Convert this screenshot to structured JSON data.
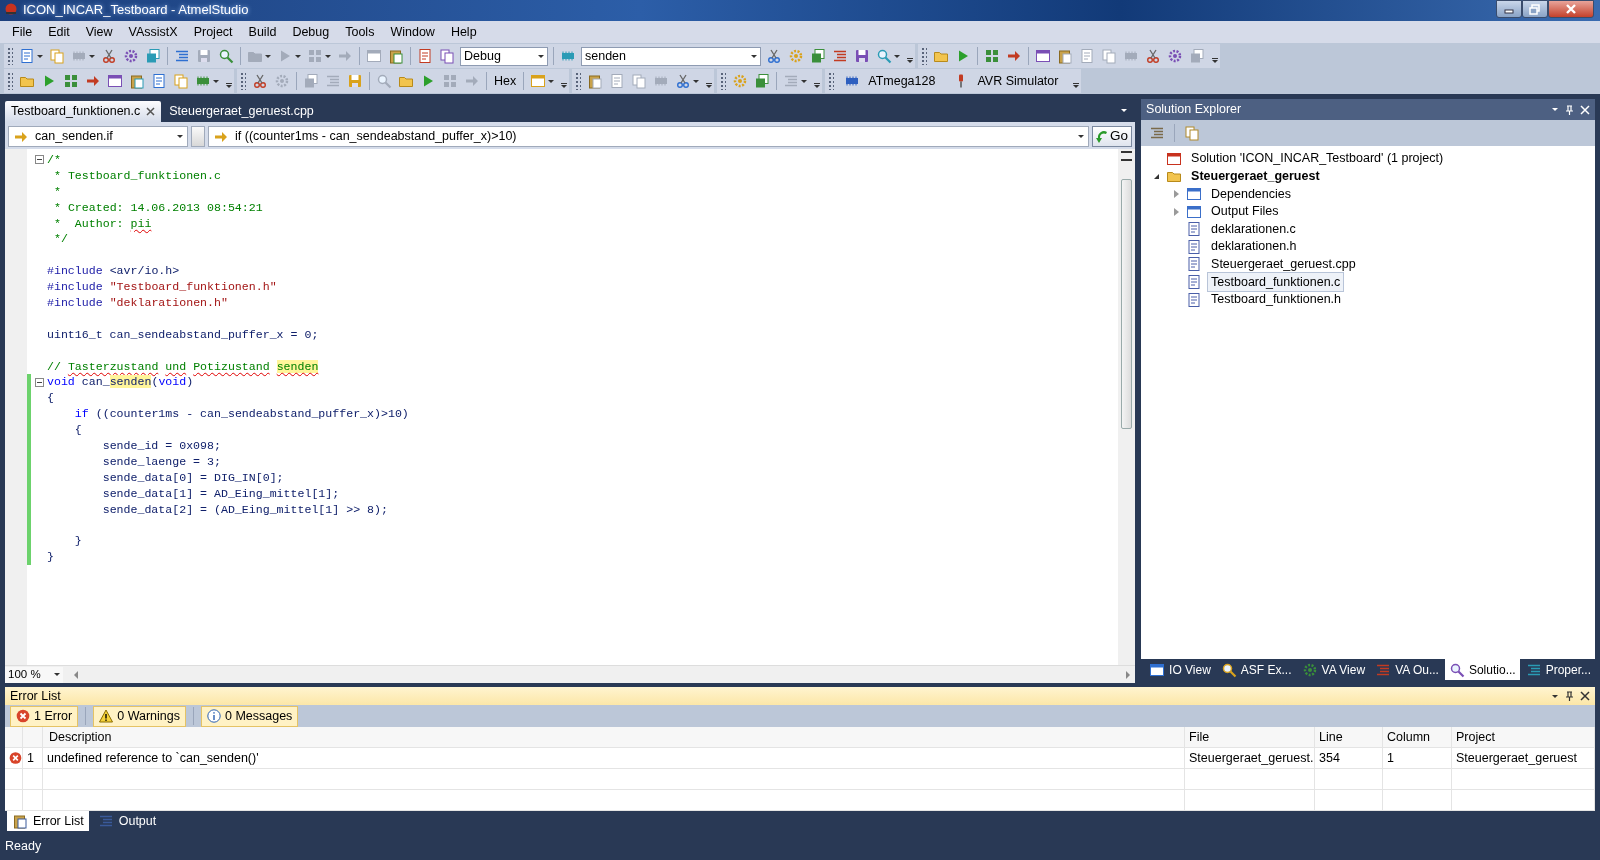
{
  "window": {
    "title": "ICON_INCAR_Testboard - AtmelStudio"
  },
  "menu": [
    "File",
    "Edit",
    "View",
    "VAssistX",
    "Project",
    "Build",
    "Debug",
    "Tools",
    "Window",
    "Help"
  ],
  "toolbar_rows": [
    [
      {
        "kind": "grip"
      },
      {
        "kind": "icon",
        "disabled": false,
        "dropdown": true
      },
      {
        "kind": "icon",
        "disabled": false,
        "dropdown": false
      },
      {
        "kind": "icon",
        "disabled": true,
        "dropdown": true
      },
      {
        "kind": "icon",
        "disabled": false,
        "dropdown": false
      },
      {
        "kind": "icon",
        "disabled": false,
        "dropdown": false
      },
      {
        "kind": "icon",
        "disabled": false,
        "dropdown": false
      },
      {
        "kind": "sep"
      },
      {
        "kind": "icon",
        "disabled": false,
        "dropdown": false
      },
      {
        "kind": "icon",
        "disabled": true,
        "dropdown": false
      },
      {
        "kind": "icon",
        "disabled": false,
        "dropdown": false
      },
      {
        "kind": "sep"
      },
      {
        "kind": "icon",
        "disabled": true,
        "dropdown": true
      },
      {
        "kind": "icon",
        "disabled": true,
        "dropdown": true
      },
      {
        "kind": "icon",
        "disabled": true,
        "dropdown": true
      },
      {
        "kind": "icon",
        "disabled": true,
        "dropdown": false
      },
      {
        "kind": "sep"
      },
      {
        "kind": "icon",
        "disabled": true,
        "dropdown": false
      },
      {
        "kind": "icon",
        "disabled": false,
        "dropdown": false
      },
      {
        "kind": "sep"
      },
      {
        "kind": "icon",
        "disabled": false,
        "dropdown": false
      },
      {
        "kind": "icon",
        "disabled": false,
        "dropdown": false
      },
      {
        "kind": "combo",
        "value": "Debug"
      },
      {
        "kind": "sep"
      },
      {
        "kind": "icon",
        "disabled": false,
        "dropdown": false
      },
      {
        "kind": "combo",
        "value": "senden"
      },
      {
        "kind": "icon",
        "disabled": false,
        "dropdown": false
      },
      {
        "kind": "icon",
        "disabled": false,
        "dropdown": false
      },
      {
        "kind": "icon",
        "disabled": false,
        "dropdown": false
      },
      {
        "kind": "icon",
        "disabled": false,
        "dropdown": false
      },
      {
        "kind": "icon",
        "disabled": false,
        "dropdown": false
      },
      {
        "kind": "icon",
        "disabled": false,
        "dropdown": true
      },
      {
        "kind": "overflow"
      },
      {
        "kind": "grip"
      },
      {
        "kind": "icon",
        "disabled": false,
        "dropdown": false
      },
      {
        "kind": "icon",
        "disabled": false,
        "dropdown": false
      },
      {
        "kind": "sep"
      },
      {
        "kind": "icon",
        "disabled": false,
        "dropdown": false
      },
      {
        "kind": "icon",
        "disabled": false,
        "dropdown": false
      },
      {
        "kind": "sep"
      },
      {
        "kind": "icon",
        "disabled": false,
        "dropdown": false
      },
      {
        "kind": "icon",
        "disabled": true,
        "dropdown": false
      },
      {
        "kind": "icon",
        "disabled": true,
        "dropdown": false
      },
      {
        "kind": "icon",
        "disabled": true,
        "dropdown": false
      },
      {
        "kind": "icon",
        "disabled": true,
        "dropdown": false
      },
      {
        "kind": "icon",
        "disabled": false,
        "dropdown": false
      },
      {
        "kind": "icon",
        "disabled": false,
        "dropdown": false
      },
      {
        "kind": "icon",
        "disabled": true,
        "dropdown": false
      },
      {
        "kind": "overflow"
      }
    ],
    [
      {
        "kind": "grip"
      },
      {
        "kind": "icon",
        "disabled": false,
        "dropdown": false
      },
      {
        "kind": "icon",
        "disabled": false,
        "dropdown": false
      },
      {
        "kind": "icon",
        "disabled": false,
        "dropdown": false
      },
      {
        "kind": "icon",
        "disabled": false,
        "dropdown": false
      },
      {
        "kind": "icon",
        "disabled": false,
        "dropdown": false
      },
      {
        "kind": "icon",
        "disabled": false,
        "dropdown": false
      },
      {
        "kind": "icon",
        "disabled": false,
        "dropdown": false
      },
      {
        "kind": "icon",
        "disabled": false,
        "dropdown": false
      },
      {
        "kind": "icon",
        "disabled": false,
        "dropdown": true
      },
      {
        "kind": "overflow"
      },
      {
        "kind": "grip"
      },
      {
        "kind": "icon",
        "disabled": false,
        "dropdown": false
      },
      {
        "kind": "icon",
        "disabled": true,
        "dropdown": false
      },
      {
        "kind": "sep"
      },
      {
        "kind": "icon",
        "disabled": true,
        "dropdown": false
      },
      {
        "kind": "icon",
        "disabled": true,
        "dropdown": false
      },
      {
        "kind": "icon",
        "disabled": false,
        "dropdown": false
      },
      {
        "kind": "sep"
      },
      {
        "kind": "icon",
        "disabled": true,
        "dropdown": false
      },
      {
        "kind": "icon",
        "disabled": false,
        "dropdown": false
      },
      {
        "kind": "icon",
        "disabled": false,
        "dropdown": false
      },
      {
        "kind": "icon",
        "disabled": true,
        "dropdown": false
      },
      {
        "kind": "icon",
        "disabled": true,
        "dropdown": false
      },
      {
        "kind": "sep"
      },
      {
        "kind": "text",
        "label": "Hex"
      },
      {
        "kind": "sep"
      },
      {
        "kind": "icon",
        "disabled": false,
        "dropdown": true
      },
      {
        "kind": "overflow"
      },
      {
        "kind": "grip"
      },
      {
        "kind": "icon",
        "disabled": true,
        "dropdown": false
      },
      {
        "kind": "icon",
        "disabled": true,
        "dropdown": false
      },
      {
        "kind": "icon",
        "disabled": true,
        "dropdown": false
      },
      {
        "kind": "icon",
        "disabled": true,
        "dropdown": false
      },
      {
        "kind": "icon",
        "disabled": false,
        "dropdown": true
      },
      {
        "kind": "overflow"
      },
      {
        "kind": "grip"
      },
      {
        "kind": "icon",
        "disabled": false,
        "dropdown": false
      },
      {
        "kind": "icon",
        "disabled": false,
        "dropdown": false
      },
      {
        "kind": "sep"
      },
      {
        "kind": "icon",
        "disabled": true,
        "dropdown": true
      },
      {
        "kind": "overflow"
      },
      {
        "kind": "grip"
      },
      {
        "kind": "labeled",
        "label": "ATmega128"
      },
      {
        "kind": "labeled",
        "label": "AVR Simulator"
      },
      {
        "kind": "overflow"
      }
    ]
  ],
  "document_tabs": [
    {
      "label": "Testboard_funktionen.c",
      "selected": true
    },
    {
      "label": "Steuergeraet_geruest.cpp",
      "selected": false
    }
  ],
  "navigation": {
    "scope": "can_senden.if",
    "member": "if ((counter1ms - can_sendeabstand_puffer_x)>10)",
    "go": "Go"
  },
  "editor": {
    "zoom": "100 %",
    "lines": [
      {
        "changed": false,
        "expanded": true,
        "segments": [
          {
            "kind": "comment",
            "text": "/*"
          }
        ]
      },
      {
        "changed": false,
        "segments": [
          {
            "kind": "comment",
            "text": " * Testboard_funktionen.c"
          }
        ]
      },
      {
        "changed": false,
        "segments": [
          {
            "kind": "comment",
            "text": " *"
          }
        ]
      },
      {
        "changed": false,
        "segments": [
          {
            "kind": "comment",
            "text": " * Created: 14.06.2013 08:54:21"
          }
        ]
      },
      {
        "changed": false,
        "segments": [
          {
            "kind": "comment",
            "text": " *  Author: "
          },
          {
            "kind": "comment",
            "text": "pii",
            "spell": true
          }
        ]
      },
      {
        "changed": false,
        "segments": [
          {
            "kind": "comment",
            "text": " */"
          }
        ]
      },
      {
        "changed": false
      },
      {
        "changed": false,
        "segments": [
          {
            "kind": "preproc",
            "text": "#include"
          },
          {
            "kind": "plain",
            "text": " <avr/io.h>"
          }
        ]
      },
      {
        "changed": false,
        "segments": [
          {
            "kind": "preproc",
            "text": "#include"
          },
          {
            "kind": "string",
            "text": " \"Testboard_funktionen.h\""
          }
        ]
      },
      {
        "changed": false,
        "segments": [
          {
            "kind": "preproc",
            "text": "#include"
          },
          {
            "kind": "string",
            "text": " \"deklarationen.h\""
          }
        ]
      },
      {
        "changed": false
      },
      {
        "changed": false,
        "segments": [
          {
            "kind": "plain",
            "text": "uint16_t can_sendeabstand_puffer_x = 0;"
          }
        ]
      },
      {
        "changed": false
      },
      {
        "changed": false,
        "segments": [
          {
            "kind": "comment",
            "text": "// "
          },
          {
            "kind": "comment",
            "text": "Tasterzustand ",
            "spell": true
          },
          {
            "kind": "comment",
            "text": "und ",
            "spell": true
          },
          {
            "kind": "comment",
            "text": "Potizustand ",
            "spell": true
          },
          {
            "kind": "comment",
            "text": "senden",
            "spell": true,
            "highlight": true
          }
        ]
      },
      {
        "changed": true,
        "expanded": true,
        "segments": [
          {
            "kind": "keyword",
            "text": "void"
          },
          {
            "kind": "plain",
            "text": " can_"
          },
          {
            "kind": "plain",
            "text": "senden",
            "highlight": true
          },
          {
            "kind": "plain",
            "text": "("
          },
          {
            "kind": "keyword",
            "text": "void"
          },
          {
            "kind": "plain",
            "text": ")"
          }
        ]
      },
      {
        "changed": true,
        "segments": [
          {
            "kind": "plain",
            "text": "{"
          }
        ]
      },
      {
        "changed": true,
        "segments": [
          {
            "kind": "keyword",
            "text": "    if"
          },
          {
            "kind": "plain",
            "text": " ((counter1ms - can_sendeabstand_puffer_x)>10)"
          }
        ]
      },
      {
        "changed": true,
        "segments": [
          {
            "kind": "plain",
            "text": "    {"
          }
        ]
      },
      {
        "changed": true,
        "segments": [
          {
            "kind": "plain",
            "text": "        sende_id = 0x098;"
          }
        ]
      },
      {
        "changed": true,
        "segments": [
          {
            "kind": "plain",
            "text": "        sende_laenge = 3;"
          }
        ]
      },
      {
        "changed": true,
        "segments": [
          {
            "kind": "plain",
            "text": "        sende_data[0] = DIG_IN[0];"
          }
        ]
      },
      {
        "changed": true,
        "segments": [
          {
            "kind": "plain",
            "text": "        sende_data[1] = AD_Eing_mittel[1];"
          }
        ]
      },
      {
        "changed": true,
        "segments": [
          {
            "kind": "plain",
            "text": "        sende_data[2] = (AD_Eing_mittel[1] >> 8);"
          }
        ]
      },
      {
        "changed": true
      },
      {
        "changed": true,
        "segments": [
          {
            "kind": "plain",
            "text": "    }"
          }
        ]
      },
      {
        "changed": true,
        "segments": [
          {
            "kind": "plain",
            "text": "}"
          }
        ]
      }
    ]
  },
  "solution_explorer": {
    "title": "Solution Explorer",
    "tree": [
      {
        "label": "Solution 'ICON_INCAR_Testboard' (1 project)",
        "kind": "solution",
        "selected": false,
        "children": [
          {
            "label": "Steuergeraet_geruest",
            "kind": "project",
            "selected": false,
            "expanded": true,
            "children": [
              {
                "label": "Dependencies",
                "kind": "folder",
                "selected": false,
                "expanded": false
              },
              {
                "label": "Output Files",
                "kind": "folder",
                "selected": false,
                "expanded": false
              },
              {
                "label": "deklarationen.c",
                "kind": "file",
                "selected": false
              },
              {
                "label": "deklarationen.h",
                "kind": "file",
                "selected": false
              },
              {
                "label": "Steuergeraet_geruest.cpp",
                "kind": "file",
                "selected": false
              },
              {
                "label": "Testboard_funktionen.c",
                "kind": "file",
                "selected": true
              },
              {
                "label": "Testboard_funktionen.h",
                "kind": "file",
                "selected": false
              }
            ]
          }
        ]
      }
    ],
    "tabs": [
      {
        "label": "IO View",
        "selected": false
      },
      {
        "label": "ASF Ex...",
        "selected": false
      },
      {
        "label": "VA View",
        "selected": false
      },
      {
        "label": "VA Ou...",
        "selected": false
      },
      {
        "label": "Solutio...",
        "selected": true
      },
      {
        "label": "Proper...",
        "selected": false
      }
    ]
  },
  "error_list": {
    "title": "Error List",
    "filters": [
      {
        "kind": "error",
        "label": "1 Error",
        "on": true
      },
      {
        "kind": "warning",
        "label": "0 Warnings",
        "on": true
      },
      {
        "kind": "info",
        "label": "0 Messages",
        "on": true
      }
    ],
    "columns": [
      "Description",
      "File",
      "Line",
      "Column",
      "Project"
    ],
    "rows": [
      {
        "kind": "error",
        "number": "1",
        "cells": [
          "undefined reference to `can_senden()'",
          "Steuergeraet_geruest.",
          "354",
          "1",
          "Steuergeraet_geruest"
        ]
      }
    ]
  },
  "bottom_tabs": [
    {
      "label": "Error List",
      "selected": true
    },
    {
      "label": "Output",
      "selected": false
    }
  ],
  "status_bar": "Ready"
}
